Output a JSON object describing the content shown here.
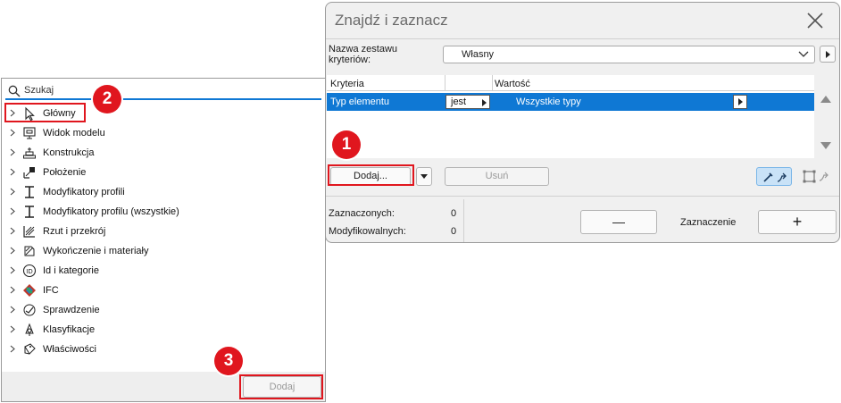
{
  "dialog": {
    "title": "Znajdź i zaznacz",
    "set_name_label": "Nazwa zestawu kryteriów:",
    "set_name_value": "Własny",
    "table": {
      "columns": [
        "Kryteria",
        "Wartość"
      ],
      "row": {
        "criterion": "Typ elementu",
        "operator": "jest",
        "value": "Wszystkie typy"
      }
    },
    "add_button": "Dodaj...",
    "remove_button": "Usuń",
    "selected_label": "Zaznaczonych:",
    "selected_count": "0",
    "editable_label": "Modyfikowalnych:",
    "editable_count": "0",
    "selection_label": "Zaznaczenie",
    "minus_button": "—",
    "plus_button": "+"
  },
  "popup": {
    "search_placeholder": "Szukaj",
    "items": [
      {
        "label": "Główny",
        "icon": "cursor-icon"
      },
      {
        "label": "Widok modelu",
        "icon": "model-view-icon"
      },
      {
        "label": "Konstrukcja",
        "icon": "construction-icon"
      },
      {
        "label": "Położenie",
        "icon": "position-icon"
      },
      {
        "label": "Modyfikatory profili",
        "icon": "profile-icon"
      },
      {
        "label": "Modyfikatory profilu (wszystkie)",
        "icon": "profile-all-icon"
      },
      {
        "label": "Rzut i przekrój",
        "icon": "plan-section-icon"
      },
      {
        "label": "Wykończenie i materiały",
        "icon": "materials-icon"
      },
      {
        "label": "Id i kategorie",
        "icon": "id-icon"
      },
      {
        "label": "IFC",
        "icon": "ifc-icon"
      },
      {
        "label": "Sprawdzenie",
        "icon": "check-icon"
      },
      {
        "label": "Klasyfikacje",
        "icon": "classification-icon"
      },
      {
        "label": "Właściwości",
        "icon": "properties-icon"
      }
    ],
    "add_button": "Dodaj"
  },
  "callouts": [
    "1",
    "2",
    "3"
  ],
  "colors": {
    "accent": "#0f78d4",
    "callout": "#e0161e"
  }
}
